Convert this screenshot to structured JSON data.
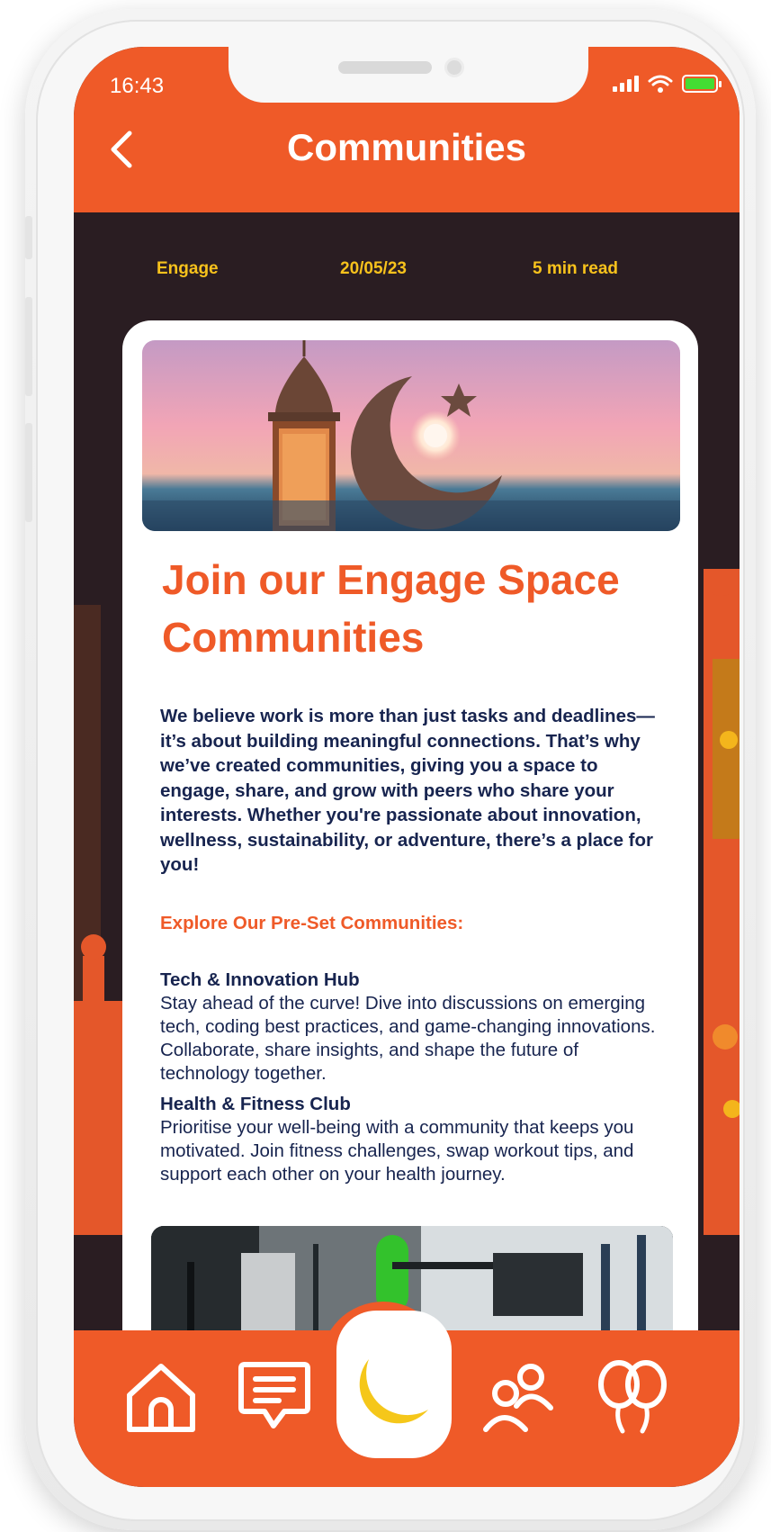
{
  "status_bar": {
    "time": "16:43"
  },
  "header": {
    "title": "Communities"
  },
  "meta": {
    "category": "Engage",
    "date": "20/05/23",
    "read_time": "5 min read"
  },
  "article": {
    "title": "Join our Engage Space Communities",
    "intro": "We believe work is more than just tasks and deadlines—it’s about building meaningful connections. That’s why we’ve created communities, giving you a space to engage, share, and grow with peers who share your interests. Whether you're passionate about innovation, wellness, sustainability, or adventure, there’s a place for you!",
    "explore_heading": "Explore Our Pre-Set Communities:",
    "sections": [
      {
        "heading": "Tech & Innovation Hub",
        "body": "Stay ahead of the curve! Dive into discussions on emerging tech, coding best practices, and game-changing innovations. Collaborate, share insights, and shape the future of technology together."
      },
      {
        "heading": "Health & Fitness Club",
        "body": "Prioritise your well-being with a community that keeps you motivated. Join fitness challenges, swap workout tips, and support each other on your health journey."
      }
    ]
  },
  "bottom_nav": {
    "items": [
      "home-icon",
      "chat-icon",
      "crescent-moon-icon",
      "people-icon",
      "balloons-icon"
    ]
  },
  "colors": {
    "brand": "#ef5a28",
    "accent": "#f7c21c",
    "text_dark": "#17244f",
    "background": "#2a1d22"
  }
}
